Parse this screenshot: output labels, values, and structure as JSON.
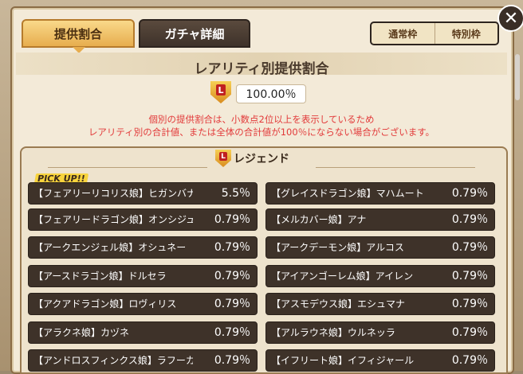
{
  "tabs": [
    {
      "label": "提供割合",
      "active": true
    },
    {
      "label": "ガチャ詳細",
      "active": false
    }
  ],
  "segment": [
    "通常枠",
    "特別枠"
  ],
  "close_label": "✕",
  "section_title": "レアリティ別提供割合",
  "total_rate": "100.00％",
  "note": [
    "個別の提供割合は、小数点2位以上を表示しているため",
    "レアリティ別の合計値、または全体の合計値が100％にならない場合がございます。"
  ],
  "list_title": "レジェンド",
  "pickup_label": "PICK UP!!",
  "left_items": [
    {
      "name": "【フェアリーリコリス娘】ヒガンバナ",
      "rate": "5.5％"
    },
    {
      "name": "【フェアリードラゴン娘】オンシジューム",
      "rate": "0.79％"
    },
    {
      "name": "【アークエンジェル娘】オシュネー",
      "rate": "0.79％"
    },
    {
      "name": "【アースドラゴン娘】ドルセラ",
      "rate": "0.79％"
    },
    {
      "name": "【アクアドラゴン娘】ロヴィリス",
      "rate": "0.79％"
    },
    {
      "name": "【アラクネ娘】カヅネ",
      "rate": "0.79％"
    },
    {
      "name": "【アンドロスフィンクス娘】ラフーカ",
      "rate": "0.79％"
    }
  ],
  "right_items": [
    {
      "name": "【グレイスドラゴン娘】マハムート",
      "rate": "0.79％"
    },
    {
      "name": "【メルカバー娘】アナ",
      "rate": "0.79％"
    },
    {
      "name": "【アークデーモン娘】アルコス",
      "rate": "0.79％"
    },
    {
      "name": "【アイアンゴーレム娘】アイレン",
      "rate": "0.79％"
    },
    {
      "name": "【アスモデウス娘】エシュマナ",
      "rate": "0.79％"
    },
    {
      "name": "【アルラウネ娘】ウルネッラ",
      "rate": "0.79％"
    },
    {
      "name": "【イフリート娘】イフィジャール",
      "rate": "0.79％"
    }
  ],
  "colors": {
    "accent": "#e7ad4e",
    "note": "#e23a3a",
    "row": "#3e3229"
  }
}
